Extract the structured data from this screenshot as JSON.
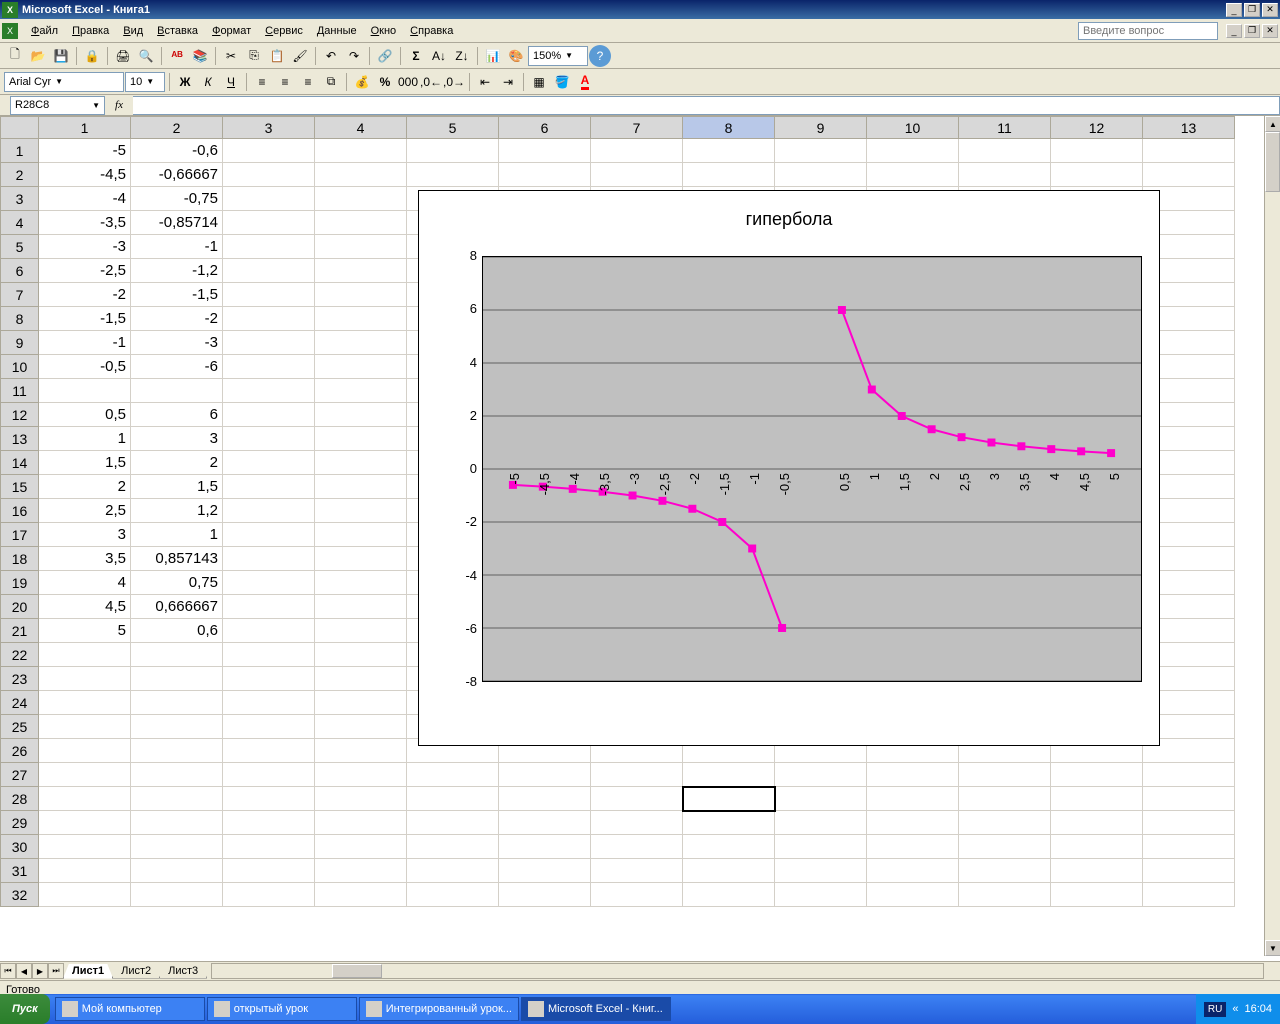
{
  "app_title": "Microsoft Excel - Книга1",
  "menus": [
    "Файл",
    "Правка",
    "Вид",
    "Вставка",
    "Формат",
    "Сервис",
    "Данные",
    "Окно",
    "Справка"
  ],
  "question_placeholder": "Введите вопрос",
  "font_name": "Arial Cyr",
  "font_size": "10",
  "zoom": "150%",
  "name_box": "R28C8",
  "columns": [
    "1",
    "2",
    "3",
    "4",
    "5",
    "6",
    "7",
    "8",
    "9",
    "10",
    "11",
    "12",
    "13"
  ],
  "rows": [
    "1",
    "2",
    "3",
    "4",
    "5",
    "6",
    "7",
    "8",
    "9",
    "10",
    "11",
    "12",
    "13",
    "14",
    "15",
    "16",
    "17",
    "18",
    "19",
    "20",
    "21",
    "22",
    "23",
    "24",
    "25",
    "26",
    "27",
    "28",
    "29",
    "30",
    "31",
    "32"
  ],
  "cells": {
    "1": {
      "1": "-5",
      "2": "-0,6"
    },
    "2": {
      "1": "-4,5",
      "2": "-0,66667"
    },
    "3": {
      "1": "-4",
      "2": "-0,75"
    },
    "4": {
      "1": "-3,5",
      "2": "-0,85714"
    },
    "5": {
      "1": "-3",
      "2": "-1"
    },
    "6": {
      "1": "-2,5",
      "2": "-1,2"
    },
    "7": {
      "1": "-2",
      "2": "-1,5"
    },
    "8": {
      "1": "-1,5",
      "2": "-2"
    },
    "9": {
      "1": "-1",
      "2": "-3"
    },
    "10": {
      "1": "-0,5",
      "2": "-6"
    },
    "12": {
      "1": "0,5",
      "2": "6"
    },
    "13": {
      "1": "1",
      "2": "3"
    },
    "14": {
      "1": "1,5",
      "2": "2"
    },
    "15": {
      "1": "2",
      "2": "1,5"
    },
    "16": {
      "1": "2,5",
      "2": "1,2"
    },
    "17": {
      "1": "3",
      "2": "1"
    },
    "18": {
      "1": "3,5",
      "2": "0,857143"
    },
    "19": {
      "1": "4",
      "2": "0,75"
    },
    "20": {
      "1": "4,5",
      "2": "0,666667"
    },
    "21": {
      "1": "5",
      "2": "0,6"
    }
  },
  "sheets": [
    "Лист1",
    "Лист2",
    "Лист3"
  ],
  "active_sheet": 0,
  "status": "Готово",
  "taskbar": {
    "start": "Пуск",
    "items": [
      {
        "label": "Мой компьютер",
        "active": false
      },
      {
        "label": "открытый урок",
        "active": false
      },
      {
        "label": "Интегрированный урок...",
        "active": false
      },
      {
        "label": "Microsoft Excel - Книг...",
        "active": true
      }
    ],
    "lang": "RU",
    "time": "16:04"
  },
  "chart_data": {
    "type": "line",
    "title": "гипербола",
    "xlabel": "",
    "ylabel": "",
    "ylim": [
      -8,
      8
    ],
    "y_ticks": [
      -8,
      -6,
      -4,
      -2,
      0,
      2,
      4,
      6,
      8
    ],
    "categories": [
      "-5",
      "-4,5",
      "-4",
      "-3,5",
      "-3",
      "-2,5",
      "-2",
      "-1,5",
      "-1",
      "-0,5",
      "",
      "0,5",
      "1",
      "1,5",
      "2",
      "2,5",
      "3",
      "3,5",
      "4",
      "4,5",
      "5"
    ],
    "values": [
      -0.6,
      -0.66667,
      -0.75,
      -0.85714,
      -1,
      -1.2,
      -1.5,
      -2,
      -3,
      -6,
      null,
      6,
      3,
      2,
      1.5,
      1.2,
      1,
      0.857143,
      0.75,
      0.666667,
      0.6
    ],
    "color": "#ff00cc"
  }
}
